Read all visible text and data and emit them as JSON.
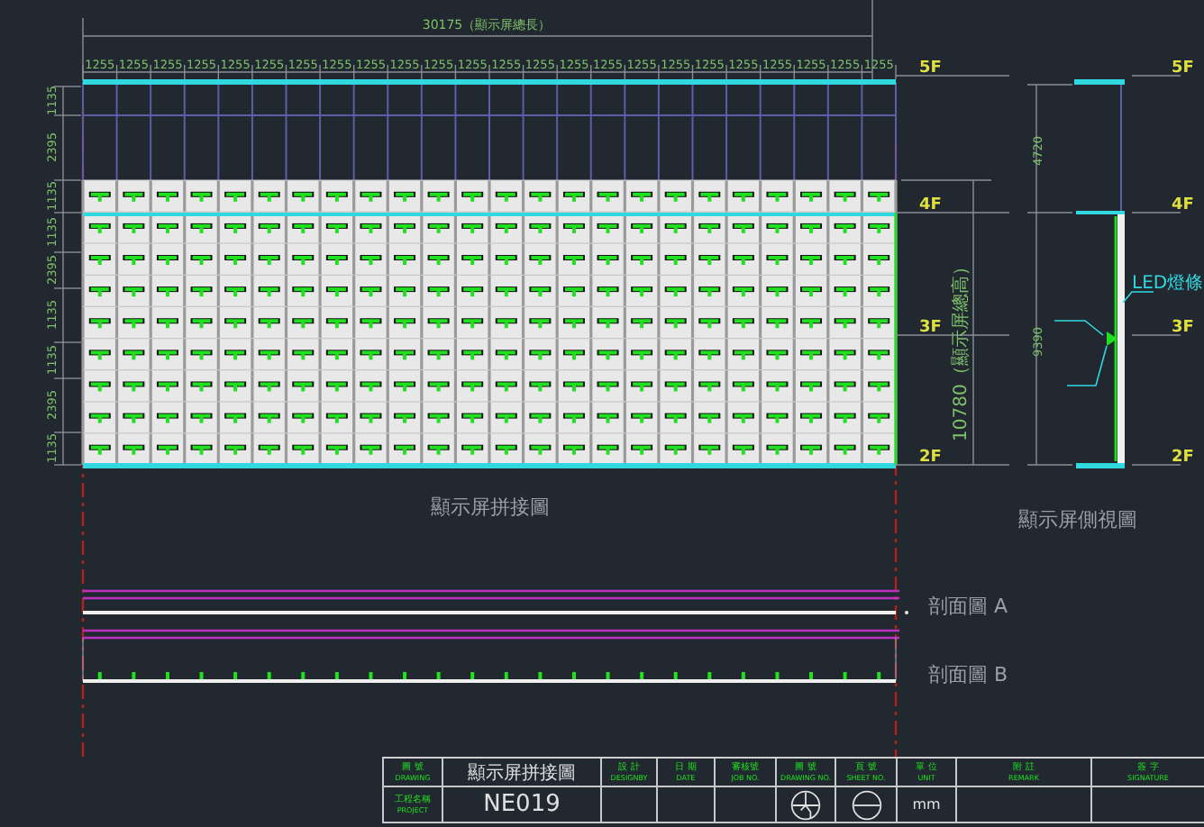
{
  "elevation": {
    "total_width": "30175（顯示屏總長）",
    "column_dims": [
      "1255",
      "1255",
      "1255",
      "1255",
      "1255",
      "1255",
      "1255",
      "1255",
      "1255",
      "1255",
      "1255",
      "1255",
      "1255",
      "1255",
      "1255",
      "1255",
      "1255",
      "1255",
      "1255",
      "1255",
      "1255",
      "1255",
      "1255",
      "1255"
    ],
    "row_dims": [
      "1135",
      "2395",
      "1135",
      "1135",
      "2395",
      "1135",
      "1135",
      "2395",
      "1135"
    ],
    "floors": [
      "5F",
      "4F",
      "3F",
      "2F"
    ],
    "caption": "顯示屏拼接圖"
  },
  "side_view": {
    "upper_dim": "4720",
    "total_height": "10780（顯示屏總高）",
    "lower_dim": "9390",
    "floors": [
      "5F",
      "4F",
      "3F",
      "2F"
    ],
    "callout": "LED燈條",
    "caption": "顯示屏側視圖"
  },
  "sections": [
    {
      "label": "剖面圖 A",
      "kind": "plain"
    },
    {
      "label": "剖面圖 B",
      "kind": "dotted"
    }
  ],
  "title_block": {
    "drawing": {
      "zh": "圖 號",
      "en": "DRAWING"
    },
    "drawing_title": "顯示屏拼接圖",
    "project": {
      "zh": "工程名稱",
      "en": "PROJECT"
    },
    "project_code": "NE019",
    "columns": [
      {
        "zh": "設 計",
        "en": "DESIGNBY",
        "kind": "blank"
      },
      {
        "zh": "日 期",
        "en": "DATE",
        "kind": "blank"
      },
      {
        "zh": "審核號",
        "en": "JOB NO.",
        "kind": "blank"
      },
      {
        "zh": "圖 號",
        "en": "DRAWING NO.",
        "kind": "projection"
      },
      {
        "zh": "頁 號",
        "en": "SHEET NO.",
        "kind": "sheet"
      },
      {
        "zh": "單 位",
        "en": "UNIT",
        "kind": "text",
        "value": "mm"
      },
      {
        "zh": "附 註",
        "en": "REMARK",
        "kind": "blank"
      },
      {
        "zh": "簽 字",
        "en": "SIGNATURE",
        "kind": "blank"
      }
    ]
  }
}
